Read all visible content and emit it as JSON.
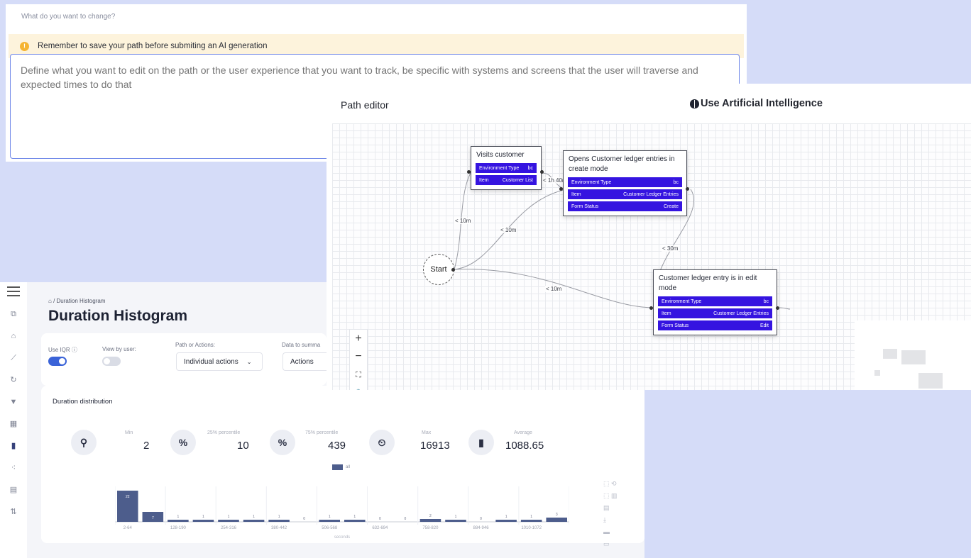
{
  "prompt": {
    "question": "What do you want to change?",
    "warning": "Remember to save your path before submiting an AI generation",
    "placeholder": "Define what you want to edit on the path or the user experience that you want to track, be specific with systems and screens that the user will traverse and expected times to do that"
  },
  "path_editor": {
    "title": "Path editor",
    "ai_title": "Use Artificial Intelligence",
    "start_label": "Start",
    "nodes": [
      {
        "title": "Visits customer",
        "props": [
          {
            "key": "Environment Type",
            "value": "bc"
          },
          {
            "key": "Item",
            "value": "Customer List"
          }
        ]
      },
      {
        "title": "Opens Customer ledger entries in create mode",
        "props": [
          {
            "key": "Environment Type",
            "value": "bc"
          },
          {
            "key": "Item",
            "value": "Customer Ledger Entries"
          },
          {
            "key": "Form Status",
            "value": "Create"
          }
        ]
      },
      {
        "title": "Customer ledger entry is in edit mode",
        "props": [
          {
            "key": "Environment Type",
            "value": "bc"
          },
          {
            "key": "Item",
            "value": "Customer Ledger Entries"
          },
          {
            "key": "Form Status",
            "value": "Edit"
          }
        ]
      }
    ],
    "edge_labels": [
      "< 10m",
      "< 10m",
      "< 1h 40m",
      "< 30m",
      "< 10m"
    ],
    "zoom_controls": [
      "+",
      "−",
      "⛶",
      "🔒",
      "⊟"
    ],
    "accent_color": "#3514e0"
  },
  "histogram_page": {
    "breadcrumb": "Duration Histogram",
    "title": "Duration Histogram",
    "filters": {
      "use_iqr_label": "Use IQR",
      "use_iqr": true,
      "view_by_user_label": "View by user:",
      "view_by_user": false,
      "path_or_actions_label": "Path or Actions:",
      "path_or_actions_value": "Individual actions",
      "data_to_summarize_label": "Data to summa",
      "data_to_summarize_value": "Actions"
    },
    "distribution": {
      "title": "Duration distribution",
      "stats": [
        {
          "label": "Min",
          "value": "2",
          "icon": "pin-icon"
        },
        {
          "label": "25% percentile",
          "value": "10",
          "icon": "percent-icon"
        },
        {
          "label": "75% percentile",
          "value": "439",
          "icon": "percent-icon"
        },
        {
          "label": "Max",
          "value": "16913",
          "icon": "timer-icon"
        },
        {
          "label": "Average",
          "value": "1088.65",
          "icon": "average-icon"
        }
      ],
      "legend": "all"
    }
  },
  "chart_data": {
    "type": "bar",
    "categories": [
      "2-64",
      "",
      "128-190",
      "",
      "254-316",
      "",
      "380-442",
      "",
      "506-568",
      "",
      "632-694",
      "",
      "758-820",
      "",
      "884-946",
      "",
      "1010-1072",
      ""
    ],
    "values": [
      22,
      7,
      1,
      1,
      1,
      1,
      1,
      0,
      1,
      1,
      0,
      0,
      2,
      1,
      0,
      1,
      1,
      3
    ],
    "data_labels": [
      "22",
      "7",
      "1",
      "1",
      "1",
      "1",
      "1",
      "0",
      "1",
      "1",
      "0",
      "0",
      "2",
      "1",
      "0",
      "1",
      "1",
      "3"
    ],
    "xlabel": "seconds",
    "ylabel": "",
    "grid": true,
    "bar_color": "#4d5d8c"
  }
}
